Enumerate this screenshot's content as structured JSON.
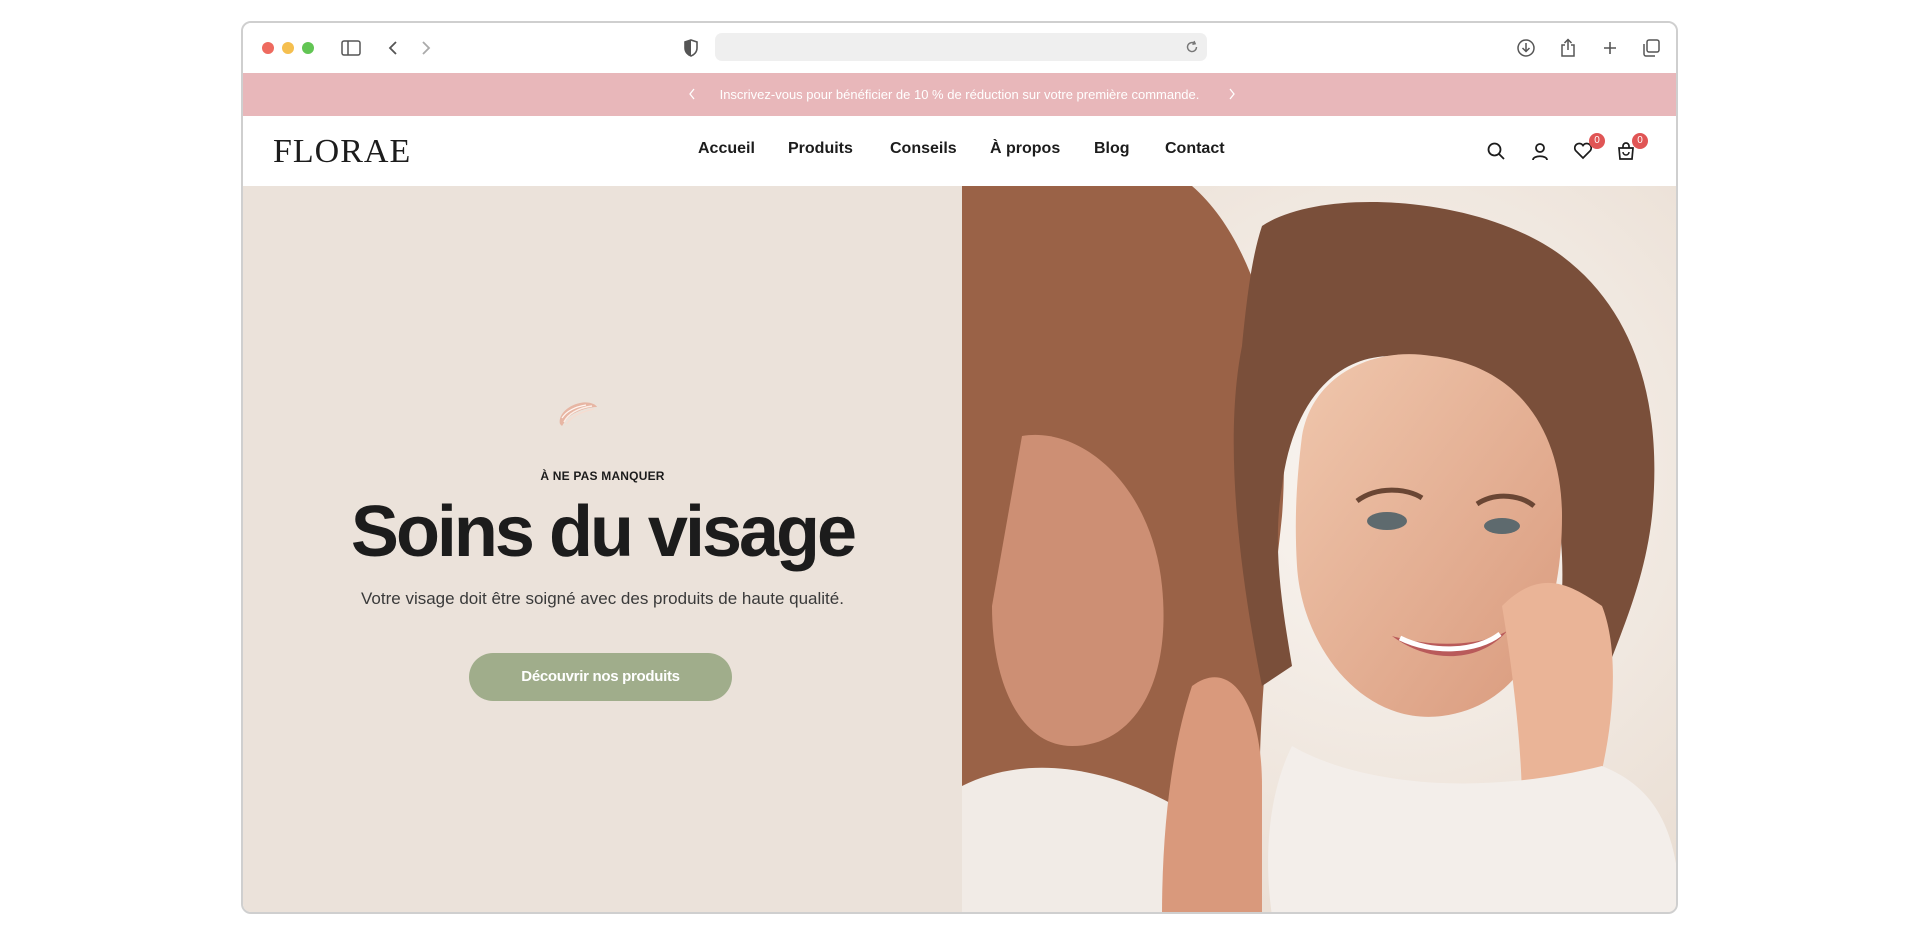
{
  "browser": {
    "url": ""
  },
  "announcement": {
    "text": "Inscrivez-vous pour bénéficier de 10 % de réduction sur votre première commande."
  },
  "header": {
    "logo": "FLORAE",
    "nav": [
      "Accueil",
      "Produits",
      "Conseils",
      "À propos",
      "Blog",
      "Contact"
    ],
    "wishlist_count": "0",
    "cart_count": "0"
  },
  "hero": {
    "eyebrow": "À NE PAS MANQUER",
    "title": "Soins du visage",
    "subtitle": "Votre visage doit être soigné avec des produits de haute qualité.",
    "cta": "Découvrir nos produits"
  },
  "colors": {
    "announcement_bg": "#e8b7ba",
    "hero_bg": "#ebe2da",
    "cta_bg": "#a0ad8b",
    "badge": "#e05555"
  }
}
